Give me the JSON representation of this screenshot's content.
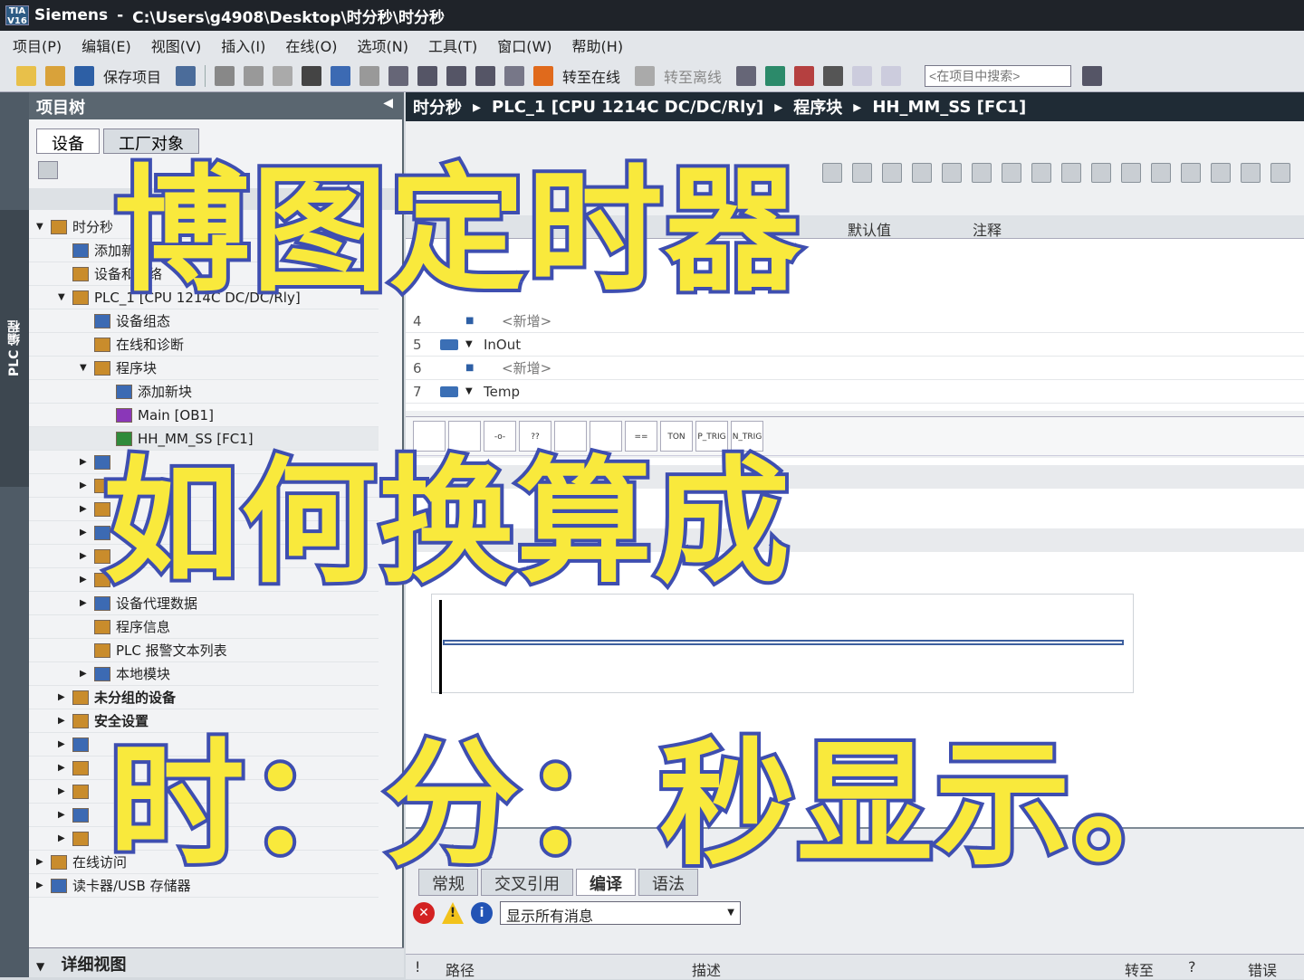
{
  "window": {
    "app": "Siemens",
    "path": "C:\\Users\\g4908\\Desktop\\时分秒\\时分秒",
    "logo": "TIA V16"
  },
  "menu": [
    "项目(P)",
    "编辑(E)",
    "视图(V)",
    "插入(I)",
    "在线(O)",
    "选项(N)",
    "工具(T)",
    "窗口(W)",
    "帮助(H)"
  ],
  "toolbar": {
    "save_label": "保存项目",
    "go_online": "转至在线",
    "go_offline": "转至离线",
    "search_placeholder": "<在项目中搜索>"
  },
  "left_strip": {
    "label": "PLC 编程"
  },
  "project_tree": {
    "title": "项目树",
    "tabs": [
      "设备",
      "工厂对象"
    ],
    "items": [
      {
        "label": "时分秒",
        "indent": 0
      },
      {
        "label": "添加新设备",
        "indent": 1
      },
      {
        "label": "设备和网络",
        "indent": 1
      },
      {
        "label": "PLC_1 [CPU 1214C DC/DC/Rly]",
        "indent": 1
      },
      {
        "label": "设备组态",
        "indent": 2
      },
      {
        "label": "在线和诊断",
        "indent": 2
      },
      {
        "label": "程序块",
        "indent": 2
      },
      {
        "label": "添加新块",
        "indent": 3
      },
      {
        "label": "Main [OB1]",
        "indent": 3
      },
      {
        "label": "HH_MM_SS [FC1]",
        "indent": 3
      },
      {
        "label": "",
        "indent": 2
      },
      {
        "label": "",
        "indent": 2
      },
      {
        "label": "",
        "indent": 2
      },
      {
        "label": "",
        "indent": 2
      },
      {
        "label": "",
        "indent": 2
      },
      {
        "label": "",
        "indent": 2
      },
      {
        "label": "设备代理数据",
        "indent": 2
      },
      {
        "label": "程序信息",
        "indent": 2
      },
      {
        "label": "PLC 报警文本列表",
        "indent": 2
      },
      {
        "label": "本地模块",
        "indent": 2
      },
      {
        "label": "未分组的设备",
        "indent": 1
      },
      {
        "label": "安全设置",
        "indent": 1
      },
      {
        "label": "",
        "indent": 1
      },
      {
        "label": "",
        "indent": 1
      },
      {
        "label": "",
        "indent": 1
      },
      {
        "label": "",
        "indent": 1
      },
      {
        "label": "",
        "indent": 1
      },
      {
        "label": "在线访问",
        "indent": 0
      },
      {
        "label": "读卡器/USB 存储器",
        "indent": 0
      }
    ],
    "detail_view": "详细视图"
  },
  "breadcrumb": [
    "时分秒",
    "PLC_1 [CPU 1214C DC/DC/Rly]",
    "程序块",
    "HH_MM_SS [FC1]"
  ],
  "interface": {
    "columns": {
      "default": "默认值",
      "comment": "注释"
    },
    "rows": [
      {
        "num": "4",
        "name": "<新增>",
        "indent": true
      },
      {
        "num": "5",
        "name": "InOut",
        "indent": false
      },
      {
        "num": "6",
        "name": "<新增>",
        "indent": true
      },
      {
        "num": "7",
        "name": "Temp",
        "indent": false
      }
    ]
  },
  "instructions": [
    "",
    "",
    "-o-",
    "??",
    "",
    "",
    "==",
    "TON",
    "P_TRIG",
    "N_TRIG"
  ],
  "inspector": {
    "tabs": [
      "常规",
      "交叉引用",
      "编译",
      "语法"
    ],
    "filter": "显示所有消息",
    "columns": [
      "!",
      "路径",
      "描述",
      "转至",
      "?",
      "错误"
    ]
  },
  "overlay": {
    "line1": "博图定时器",
    "line2": "如何换算成",
    "line3": "时：分：秒显示。"
  },
  "colors": {
    "overlay_fill": "#f9e93c",
    "overlay_stroke": "#3f4fb0",
    "title_bg": "#1f2329",
    "breadcrumb_bg": "#1f2b35"
  }
}
